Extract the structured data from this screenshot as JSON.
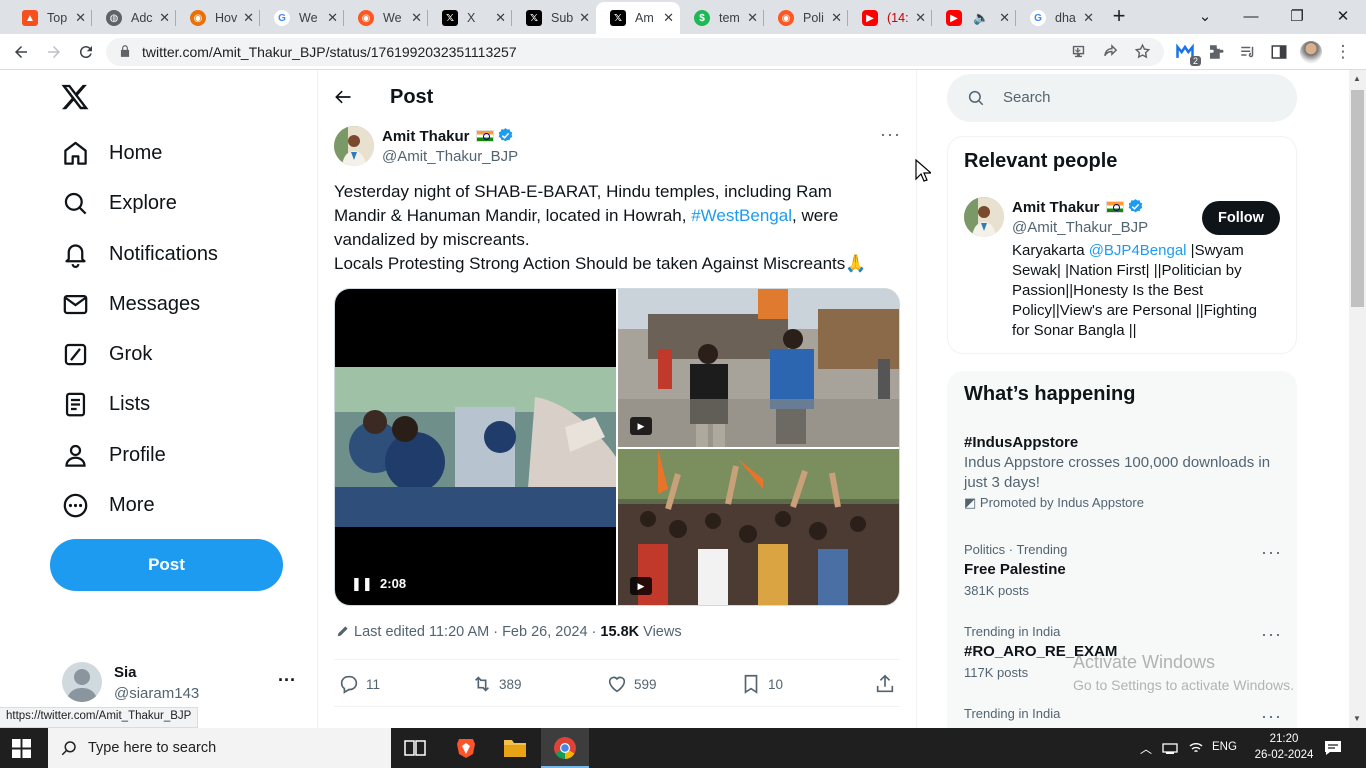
{
  "browser": {
    "tabs": [
      {
        "title": "Top",
        "icon": "red-a-favicon",
        "color": "#f4511e"
      },
      {
        "title": "Adc",
        "icon": "globe-favicon",
        "color": "#5f6368"
      },
      {
        "title": "Hov",
        "icon": "hostinger-favicon",
        "color": "#e8710a"
      },
      {
        "title": "We",
        "icon": "google-favicon",
        "color": "#4285f4"
      },
      {
        "title": "We",
        "icon": "orange-favicon",
        "color": "#ff5722"
      },
      {
        "title": "X",
        "icon": "x-favicon",
        "color": "#000000"
      },
      {
        "title": "Sub",
        "icon": "x-favicon",
        "color": "#000000"
      },
      {
        "title": "Am",
        "icon": "x-favicon",
        "color": "#000000"
      },
      {
        "title": "tem",
        "icon": "green-favicon",
        "color": "#1db954"
      },
      {
        "title": "Poli",
        "icon": "orange-favicon",
        "color": "#ff5722"
      },
      {
        "title": "(14:",
        "icon": "youtube-favicon",
        "color": "#ff0000"
      },
      {
        "title": "",
        "icon": "youtube-favicon",
        "color": "#ff0000"
      },
      {
        "title": "dha",
        "icon": "google-favicon",
        "color": "#4285f4"
      }
    ],
    "url": "twitter.com/Amit_Thakur_BJP/status/1761992032351113257",
    "extension_badge": "2",
    "status_url": "https://twitter.com/Amit_Thakur_BJP"
  },
  "nav": {
    "items": [
      {
        "label": "Home",
        "icon": "home-icon"
      },
      {
        "label": "Explore",
        "icon": "search-icon"
      },
      {
        "label": "Notifications",
        "icon": "bell-icon"
      },
      {
        "label": "Messages",
        "icon": "mail-icon"
      },
      {
        "label": "Grok",
        "icon": "grok-icon"
      },
      {
        "label": "Lists",
        "icon": "list-icon"
      },
      {
        "label": "Profile",
        "icon": "person-icon"
      },
      {
        "label": "More",
        "icon": "more-circle-icon"
      }
    ],
    "post_label": "Post",
    "account": {
      "name": "Sia",
      "handle": "@siaram143"
    }
  },
  "main": {
    "header_title": "Post",
    "author": {
      "name": "Amit Thakur",
      "handle": "@Amit_Thakur_BJP"
    },
    "text_lines": [
      "Yesterday night of SHAB-E-BARAT,  Hindu temples, including Ram",
      "Mandir & Hanuman Mandir, located in Howrah, ",
      "#WestBengal",
      ", were",
      "vandalized by miscreants.",
      "Locals Protesting Strong Action Should be taken Against Miscreants🙏"
    ],
    "video_time": "2:08",
    "edited_text": "Last edited 11:20 AM · Feb 26, 2024 · ",
    "views_count": "15.8K",
    "views_label": " Views",
    "replies": "11",
    "reposts": "389",
    "likes": "599",
    "bookmarks": "10"
  },
  "sidebar": {
    "search_placeholder": "Search",
    "relevant_title": "Relevant people",
    "person": {
      "name": "Amit Thakur",
      "handle": "@Amit_Thakur_BJP",
      "follow_label": "Follow",
      "bio_prefix": "Karyakarta ",
      "bio_link": "@BJP4Bengal",
      "bio_rest": " |Swyam Sewak| |Nation First| ||Politician by Passion||Honesty Is the Best Policy||View's are Personal ||Fighting for Sonar Bangla ||"
    },
    "happening_title": "What’s happening",
    "trends": [
      {
        "tag": "#IndusAppstore",
        "desc": "Indus Appstore crosses 100,000 downloads in just 3 days!",
        "promo": "Promoted by Indus Appstore"
      },
      {
        "context": "Politics · Trending",
        "name": "Free Palestine",
        "posts": "381K posts"
      },
      {
        "context": "Trending in India",
        "name": "#RO_ARO_RE_EXAM",
        "posts": "117K posts"
      },
      {
        "context": "Trending in India",
        "name": ""
      }
    ]
  },
  "watermark": {
    "line1": "Activate Windows",
    "line2": "Go to Settings to activate Windows."
  },
  "taskbar": {
    "search_placeholder": "Type here to search",
    "lang": "ENG",
    "time": "21:20",
    "date": "26-02-2024"
  }
}
